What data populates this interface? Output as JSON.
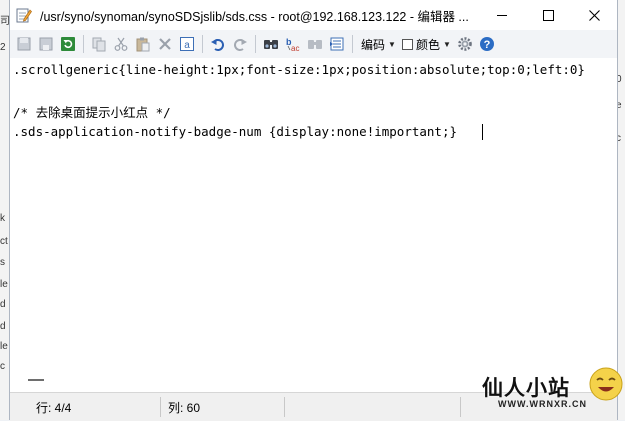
{
  "window": {
    "title": "/usr/syno/synoman/synoSDSjslib/sds.css - root@192.168.123.122 - 编辑器 ..."
  },
  "toolbar": {
    "encoding_label": "编码",
    "color_label": "颜色",
    "icons": [
      "new-file-icon",
      "save-icon",
      "refresh-icon",
      "copy-icon",
      "cut-icon",
      "paste-icon",
      "delete-icon",
      "select-all-icon",
      "undo-icon",
      "redo-icon",
      "find-icon",
      "replace-icon",
      "find-next-icon",
      "goto-line-icon",
      "settings-icon",
      "help-icon"
    ]
  },
  "editor": {
    "lines": [
      ".scrollgeneric{line-height:1px;font-size:1px;position:absolute;top:0;left:0}",
      "",
      "/* 去除桌面提示小红点 */",
      ".sds-application-notify-badge-num {display:none!important;}"
    ]
  },
  "status": {
    "line": "行: 4/4",
    "column": "列: 60"
  },
  "watermark": {
    "title": "仙人小站",
    "subtitle": "WWW.WRNXR.CN"
  },
  "background": {
    "left_chars": [
      "司",
      "2",
      "k",
      "ct",
      "s",
      "le",
      "d",
      "d",
      "le",
      "c"
    ],
    "right_chars": [
      "0",
      "e",
      "c",
      "",
      "",
      "",
      "",
      "",
      "",
      "",
      ""
    ]
  }
}
